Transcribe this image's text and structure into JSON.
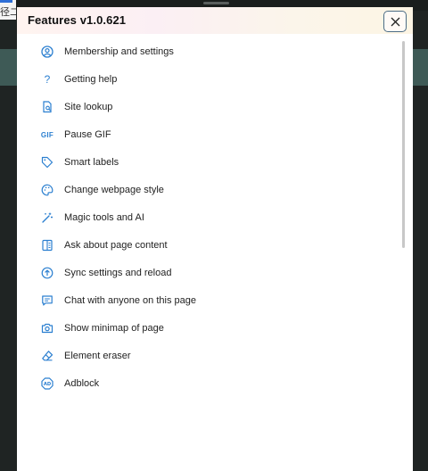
{
  "background": {
    "corner_text": "径二"
  },
  "panel": {
    "title": "Features v1.0.621",
    "close_label": "×"
  },
  "colors": {
    "accent": "#2b7fd0",
    "close_border": "#4c6d86",
    "band": "#3e5a56"
  },
  "menu": {
    "items": [
      {
        "label": "Membership and settings",
        "icon": "user-circle-icon"
      },
      {
        "label": "Getting help",
        "icon": "question-icon"
      },
      {
        "label": "Site lookup",
        "icon": "document-search-icon"
      },
      {
        "label": "Pause GIF",
        "icon": "gif-icon"
      },
      {
        "label": "Smart labels",
        "icon": "tag-icon"
      },
      {
        "label": "Change webpage style",
        "icon": "palette-icon"
      },
      {
        "label": "Magic tools and AI",
        "icon": "magic-wand-icon"
      },
      {
        "label": "Ask about page content",
        "icon": "page-content-icon"
      },
      {
        "label": "Sync settings and reload",
        "icon": "sync-arrow-icon"
      },
      {
        "label": "Chat with anyone on this page",
        "icon": "chat-bubble-icon"
      },
      {
        "label": "Show minimap of page",
        "icon": "camera-icon"
      },
      {
        "label": "Element eraser",
        "icon": "eraser-icon"
      },
      {
        "label": "Adblock",
        "icon": "adblock-icon"
      }
    ]
  }
}
